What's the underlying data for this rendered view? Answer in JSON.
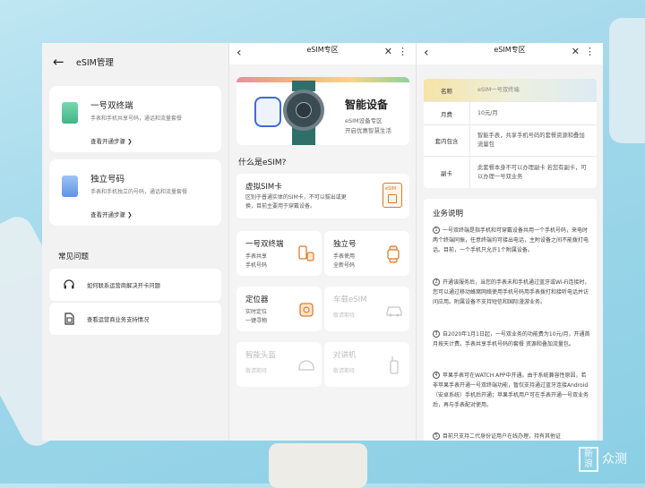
{
  "panel1": {
    "title": "eSIM管理",
    "plans": [
      {
        "title": "一号双终端",
        "desc": "手表和手机共享号码，通话和流量套餐",
        "link": "查看开通步骤 ❯"
      },
      {
        "title": "独立号码",
        "desc": "手表和手机独立的号码，通话和流量套餐",
        "link": "查看开通步骤 ❯"
      }
    ],
    "faq_header": "常见问题",
    "faq": [
      {
        "text": "如何联系运营商解决开卡问题"
      },
      {
        "text": "查看运营商业务支持情况"
      }
    ]
  },
  "panel2": {
    "title": "eSIM专区",
    "banner": {
      "title": "智能设备",
      "sub1": "eSIM设备专区",
      "sub2": "开启优惠智慧生活"
    },
    "what_title": "什么是eSIM?",
    "virtual": {
      "title": "虚拟SIM卡",
      "desc1": "区别于普通实体的SIM卡，不可以拔出或更",
      "desc2": "换，目前主要用于穿戴设备。",
      "icon_label": "eSIM"
    },
    "tiles": [
      {
        "title": "一号双终端",
        "desc1": "手表共享",
        "desc2": "手机号码",
        "disabled": false
      },
      {
        "title": "独立号",
        "desc1": "手表使用",
        "desc2": "全新号码",
        "disabled": false
      },
      {
        "title": "定位器",
        "desc1": "实时定位",
        "desc2": "一键寻物",
        "disabled": false
      },
      {
        "title": "车载eSIM",
        "desc1": "敬请期待",
        "desc2": "",
        "disabled": true
      },
      {
        "title": "智能头盔",
        "desc1": "敬请期待",
        "desc2": "",
        "disabled": true
      },
      {
        "title": "对讲机",
        "desc1": "敬请期待",
        "desc2": "",
        "disabled": true
      }
    ]
  },
  "panel3": {
    "title": "eSIM专区",
    "info": [
      {
        "key": "名称",
        "val": "eSIM一号双终端"
      },
      {
        "key": "月费",
        "val": "10元/月"
      },
      {
        "key": "套内包含",
        "val": "智能手表，共享手机号码的套餐资源和叠加流量包"
      },
      {
        "key": "副卡",
        "val": "此套餐本身不可以办理副卡 若您有副卡，可以办理一号双业务"
      }
    ],
    "biz_title": "业务说明",
    "paras": [
      {
        "num": "1",
        "text": "一号双终端是指手机和可穿戴设备共用一个手机号码，来电时两个终端同振，任意终端均可接出电话，主附设备之间不能拨打电话。目前，一个手机只允许1个附属设备。"
      },
      {
        "num": "2",
        "text": "开通该服务后，当您的手表未和手机通过蓝牙或Wi-Fi连接时，您可以通过移动蜂窝网络使用手机号码用手表拨打和接听电话并访问应用。附属设备不支持短信和国际漫游业务。"
      },
      {
        "num": "3",
        "text": "自2020年1月1日起，一号双业务的功能费为10元/月，开通首月按天计费。手表共享手机号码的套餐 资源和叠加流量包。"
      },
      {
        "num": "4",
        "text": "苹果手表可在WATCH APP中开通。由于系统兼容性原因，若非苹果手表开通一号双终端功能，暂仅支持通过蓝牙连接Android（安卓系统）手机后开通；苹果手机用户可在手表开通一号双业务后，再与手表配对使用。"
      },
      {
        "num": "5",
        "text": "目前只支持二代身份证用户在线办理，持有其他证"
      }
    ]
  },
  "watermark": {
    "box": "新浪",
    "text": "众测"
  }
}
